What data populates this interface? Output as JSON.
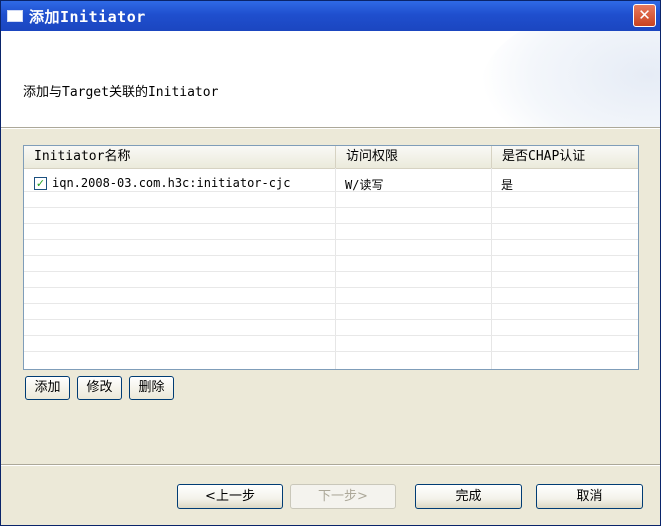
{
  "window": {
    "title": "添加Initiator",
    "close_glyph": "✕"
  },
  "header": {
    "description": "添加与Target关联的Initiator"
  },
  "table": {
    "columns": [
      "Initiator名称",
      "访问权限",
      "是否CHAP认证"
    ],
    "rows": [
      {
        "checked": true,
        "check_glyph": "✓",
        "name": "iqn.2008-03.com.h3c:initiator-cjc",
        "access": "W/读写",
        "chap": "是"
      }
    ]
  },
  "actions": {
    "add_label": "添加",
    "edit_label": "修改",
    "delete_label": "删除"
  },
  "footer": {
    "back_label": "<上一步",
    "next_label": "下一步>",
    "finish_label": "完成",
    "cancel_label": "取消"
  },
  "icons": {
    "window_icon": "window-icon",
    "close_icon": "close-icon",
    "checkbox_icon": "checkbox-checked-icon"
  },
  "colors": {
    "titlebar": "#1f4fce",
    "dialog_bg": "#ece9d8",
    "close_button": "#c9421f"
  }
}
